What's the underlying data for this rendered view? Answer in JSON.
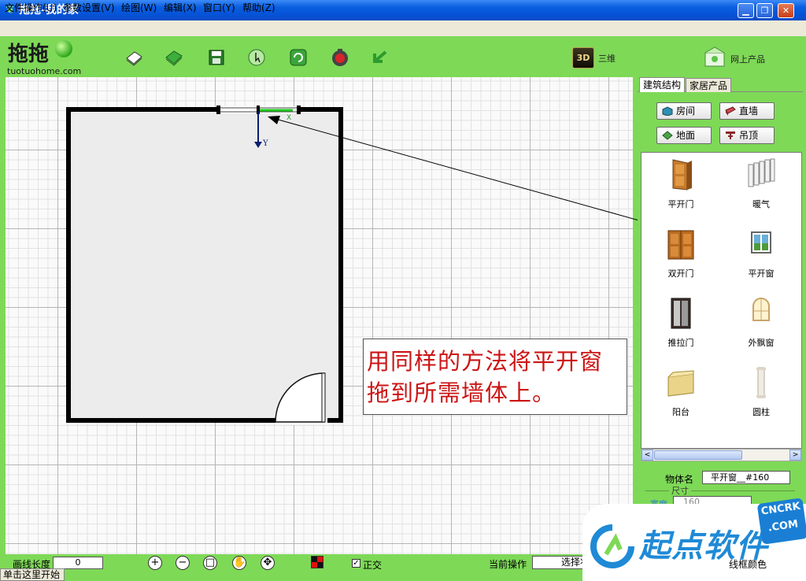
{
  "window": {
    "title": "拖拖-我的家",
    "minimize": "▁",
    "maximize": "❐",
    "close": "✕"
  },
  "menu": [
    "文件操作(U)",
    "参数设置(V)",
    "绘图(W)",
    "编辑(X)",
    "窗口(Y)",
    "帮助(Z)"
  ],
  "toolbar": {
    "logo_text": "拖拖",
    "logo_url": "tuotuohome.com",
    "icons": [
      "new-icon",
      "open-icon",
      "save-icon",
      "select-icon",
      "refresh-icon",
      "record-icon",
      "undo-icon"
    ],
    "btn_3d_icon": "3D",
    "btn_3d_label": "三维",
    "web_label": "网上产品"
  },
  "canvas": {
    "axis_y": "Y",
    "axis_x": "X",
    "note_line_1": "用同样的方法将平开窗",
    "note_line_2": "拖到所需墙体上。"
  },
  "panel": {
    "tabs": [
      "建筑结构",
      "家居产品"
    ],
    "buttons": {
      "room": "房间",
      "wall": "直墙",
      "floor": "地面",
      "ceiling": "吊顶"
    },
    "objects": [
      {
        "label": "平开门",
        "icon": "door-icon"
      },
      {
        "label": "暖气",
        "icon": "radiator-icon"
      },
      {
        "label": "双开门",
        "icon": "double-door-icon"
      },
      {
        "label": "平开窗",
        "icon": "casement-window-icon"
      },
      {
        "label": "推拉门",
        "icon": "sliding-door-icon"
      },
      {
        "label": "外飘窗",
        "icon": "bay-window-icon"
      },
      {
        "label": "阳台",
        "icon": "balcony-icon"
      },
      {
        "label": "圆柱",
        "icon": "column-icon"
      }
    ],
    "scroll_left": "<",
    "scroll_right": ">"
  },
  "properties": {
    "name_label": "物体名",
    "name_value": "平开窗__#160",
    "size_label": "尺寸",
    "width_label": "宽度",
    "width_value": "160"
  },
  "bottombar": {
    "length_label": "画线长度",
    "length_value": "0",
    "zoom_in": "+",
    "zoom_out": "−",
    "fit": "□",
    "pan": "✋",
    "move": "✥",
    "ortho_check": "✓",
    "ortho_label": "正交",
    "op_label": "当前操作",
    "op_value": "选择状态",
    "border_color_label": "线框颜色",
    "status": "单击这里开始"
  },
  "watermark": {
    "text": "起点软件",
    "badge_top": "CNCRK",
    "badge_bottom": ".COM"
  }
}
